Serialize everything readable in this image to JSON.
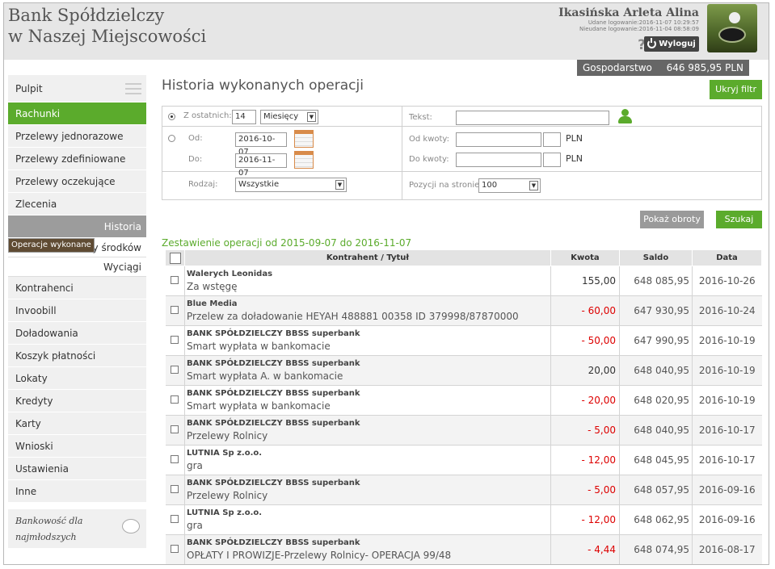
{
  "bank": {
    "line1": "Bank Spółdzielczy",
    "line2": "w Naszej Miejscowości"
  },
  "user": {
    "name": "Ikasińska Arleta Alina",
    "login_ok": "Udane logowanie:2016-11-07 10:29:57",
    "login_fail": "Nieudane logowanie:2016-11-04 08:58:09",
    "help": "?",
    "logout": "Wyloguj"
  },
  "account": {
    "name": "Gospodarstwo",
    "balance": "646 985,95 PLN"
  },
  "sidebar": {
    "pulpit": "Pulpit",
    "rachunki": "Rachunki",
    "items_top": [
      "Przelewy jednorazowe",
      "Przelewy zdefiniowane",
      "Przelewy oczekujące",
      "Zlecenia"
    ],
    "historia": "Historia",
    "sub": [
      "Operacje wykonane",
      "Blokady środków",
      "Wyciągi"
    ],
    "items_bottom": [
      "Kontrahenci",
      "Invoobill",
      "Doładowania",
      "Koszyk płatności",
      "Lokaty",
      "Kredyty",
      "Karty",
      "Wnioski",
      "Ustawienia",
      "Inne"
    ],
    "promo": "Bankowość dla najmłodszych"
  },
  "main": {
    "title": "Historia wykonanych operacji",
    "hide_filter": "Ukryj filtr",
    "caption": "Zestawienie operacji od 2015-09-07 do 2016-11-07"
  },
  "filter": {
    "last_label": "Z ostatnich:",
    "last_value": "14",
    "period": "Miesięcy",
    "from_label": "Od:",
    "from_value": "2016-10-07",
    "to_label": "Do:",
    "to_value": "2016-11-07",
    "type_label": "Rodzaj:",
    "type_value": "Wszystkie",
    "text_label": "Tekst:",
    "text_value": "",
    "amount_from_label": "Od kwoty:",
    "amount_to_label": "Do kwoty:",
    "currency": "PLN",
    "per_page_label": "Pozycji na stronie:",
    "per_page_value": "100",
    "show_turnover": "Pokaż obroty",
    "search": "Szukaj"
  },
  "table": {
    "headers": [
      "Kontrahent / Tytuł",
      "Kwota",
      "Saldo",
      "Data"
    ],
    "rows": [
      {
        "party": "Walerych Leonidas",
        "title": "Za wstęgę",
        "amount": "155,00",
        "balance": "648 085,95",
        "date": "2016-10-26",
        "neg": false
      },
      {
        "party": "Blue Media",
        "title": "Przelew za doładowanie HEYAH 488881 00358 ID 379998/87870000",
        "amount": "- 60,00",
        "balance": "647 930,95",
        "date": "2016-10-24",
        "neg": true
      },
      {
        "party": "BANK SPÓŁDZIELCZY BBSS superbank",
        "title": "Smart wypłata w bankomacie",
        "amount": "- 50,00",
        "balance": "647 990,95",
        "date": "2016-10-19",
        "neg": true
      },
      {
        "party": "BANK SPÓŁDZIELCZY BBSS superbank",
        "title": "Smart wypłata A. w bankomacie",
        "amount": "20,00",
        "balance": "648 040,95",
        "date": "2016-10-19",
        "neg": false
      },
      {
        "party": "BANK SPÓŁDZIELCZY BBSS superbank",
        "title": "Smart wypłata w bankomacie",
        "amount": "- 20,00",
        "balance": "648 020,95",
        "date": "2016-10-19",
        "neg": true
      },
      {
        "party": "BANK SPÓŁDZIELCZY BBSS superbank",
        "title": "Przelewy Rolnicy",
        "amount": "- 5,00",
        "balance": "648 040,95",
        "date": "2016-10-17",
        "neg": true
      },
      {
        "party": "LUTNIA Sp z.o.o.",
        "title": "gra",
        "amount": "- 12,00",
        "balance": "648 045,95",
        "date": "2016-10-17",
        "neg": true
      },
      {
        "party": "BANK SPÓŁDZIELCZY BBSS superbank",
        "title": "Przelewy Rolnicy",
        "amount": "- 5,00",
        "balance": "648 057,95",
        "date": "2016-09-16",
        "neg": true
      },
      {
        "party": "LUTNIA Sp z.o.o.",
        "title": "gra",
        "amount": "- 12,00",
        "balance": "648 062,95",
        "date": "2016-09-16",
        "neg": true
      },
      {
        "party": "BANK SPÓŁDZIELCZY BBSS superbank",
        "title": "OPŁATY I PROWIZJE-Przelewy Rolnicy- OPERACJA 99/48",
        "amount": "- 4,44",
        "balance": "648 074,95",
        "date": "2016-08-17",
        "neg": true
      }
    ]
  }
}
